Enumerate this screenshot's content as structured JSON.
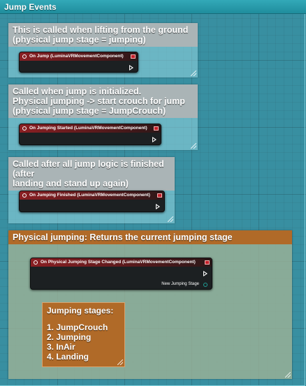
{
  "window": {
    "title": "Jump Events"
  },
  "comments": [
    {
      "text": "This is called when lifting from the ground\n(physical jump stage = jumping)",
      "node": {
        "title": "On Jump (LuminaVRMovementComponent)"
      }
    },
    {
      "text": "Called when jump is initialized.\nPhysical jumping -> start crouch for jump\n(physical jump stage = JumpCrouch)",
      "node": {
        "title": "On Jumping Started (LuminaVRMovementComponent)"
      }
    },
    {
      "text": "Called after all jump logic is finished (after\nlanding and stand up again)",
      "node": {
        "title": "On Jumping Finished (LuminaVRMovementComponent)"
      }
    }
  ],
  "group": {
    "title": "Physical jumping: Returns the current jumping stage",
    "node": {
      "title": "On Physical Jumping Stage Changed (LuminaVRMovementComponent)",
      "pin_label": "New Jumping Stage"
    },
    "stages_note": {
      "title": "Jumping stages:",
      "items": [
        "1. JumpCrouch",
        "2. Jumping",
        "3. InAir",
        "4. Landing"
      ]
    }
  },
  "colors": {
    "node_header": "#8a1f23",
    "group_header": "#b06a28",
    "struct_pin": "#1f9f97"
  },
  "icons": {
    "event": "event-icon",
    "delegate": "delegate-pin-icon",
    "exec": "exec-pin-icon",
    "resize": "resize-grip-icon"
  }
}
